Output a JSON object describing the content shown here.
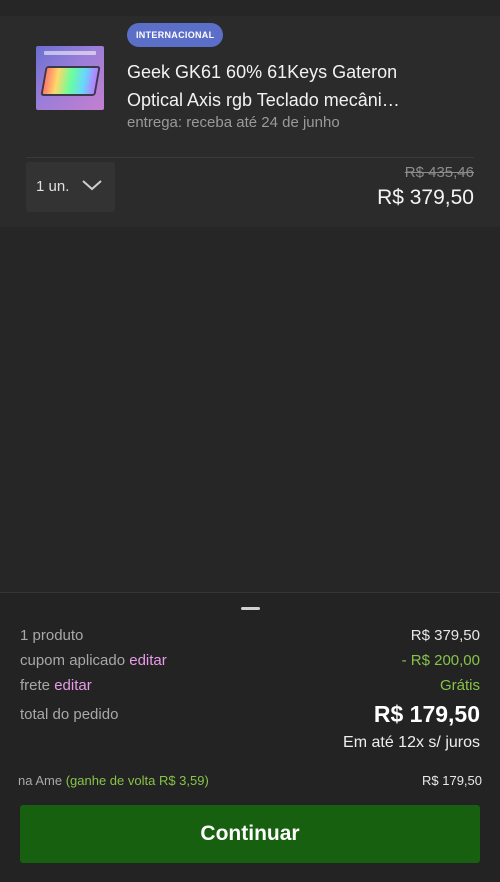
{
  "product": {
    "badge": "INTERNACIONAL",
    "image_icon": "keyboard-product-image",
    "title_line1": "Geek GK61 60% 61Keys Gateron",
    "title_line2": "Optical Axis rgb Teclado mecâni…",
    "delivery": "entrega: receba até 24 de junho",
    "quantity": "1 un.",
    "old_price": "R$ 435,46",
    "price": "R$ 379,50"
  },
  "summary": {
    "products_label": "1 produto",
    "products_value": "R$ 379,50",
    "coupon_label": "cupom aplicado",
    "coupon_edit": "editar",
    "coupon_value": "- R$ 200,00",
    "shipping_label": "frete",
    "shipping_edit": "editar",
    "shipping_value": "Grátis",
    "total_label": "total do pedido",
    "total_value": "R$ 179,50",
    "installments": "Em até 12x s/ juros",
    "ame_label": "na Ame",
    "ame_cashback": "(ganhe de volta R$ 3,59)",
    "ame_value": "R$ 179,50",
    "continue_label": "Continuar"
  },
  "colors": {
    "badge": "#5b6fc9",
    "link": "#e79be8",
    "green": "#86c34a",
    "cta": "#17600f"
  }
}
